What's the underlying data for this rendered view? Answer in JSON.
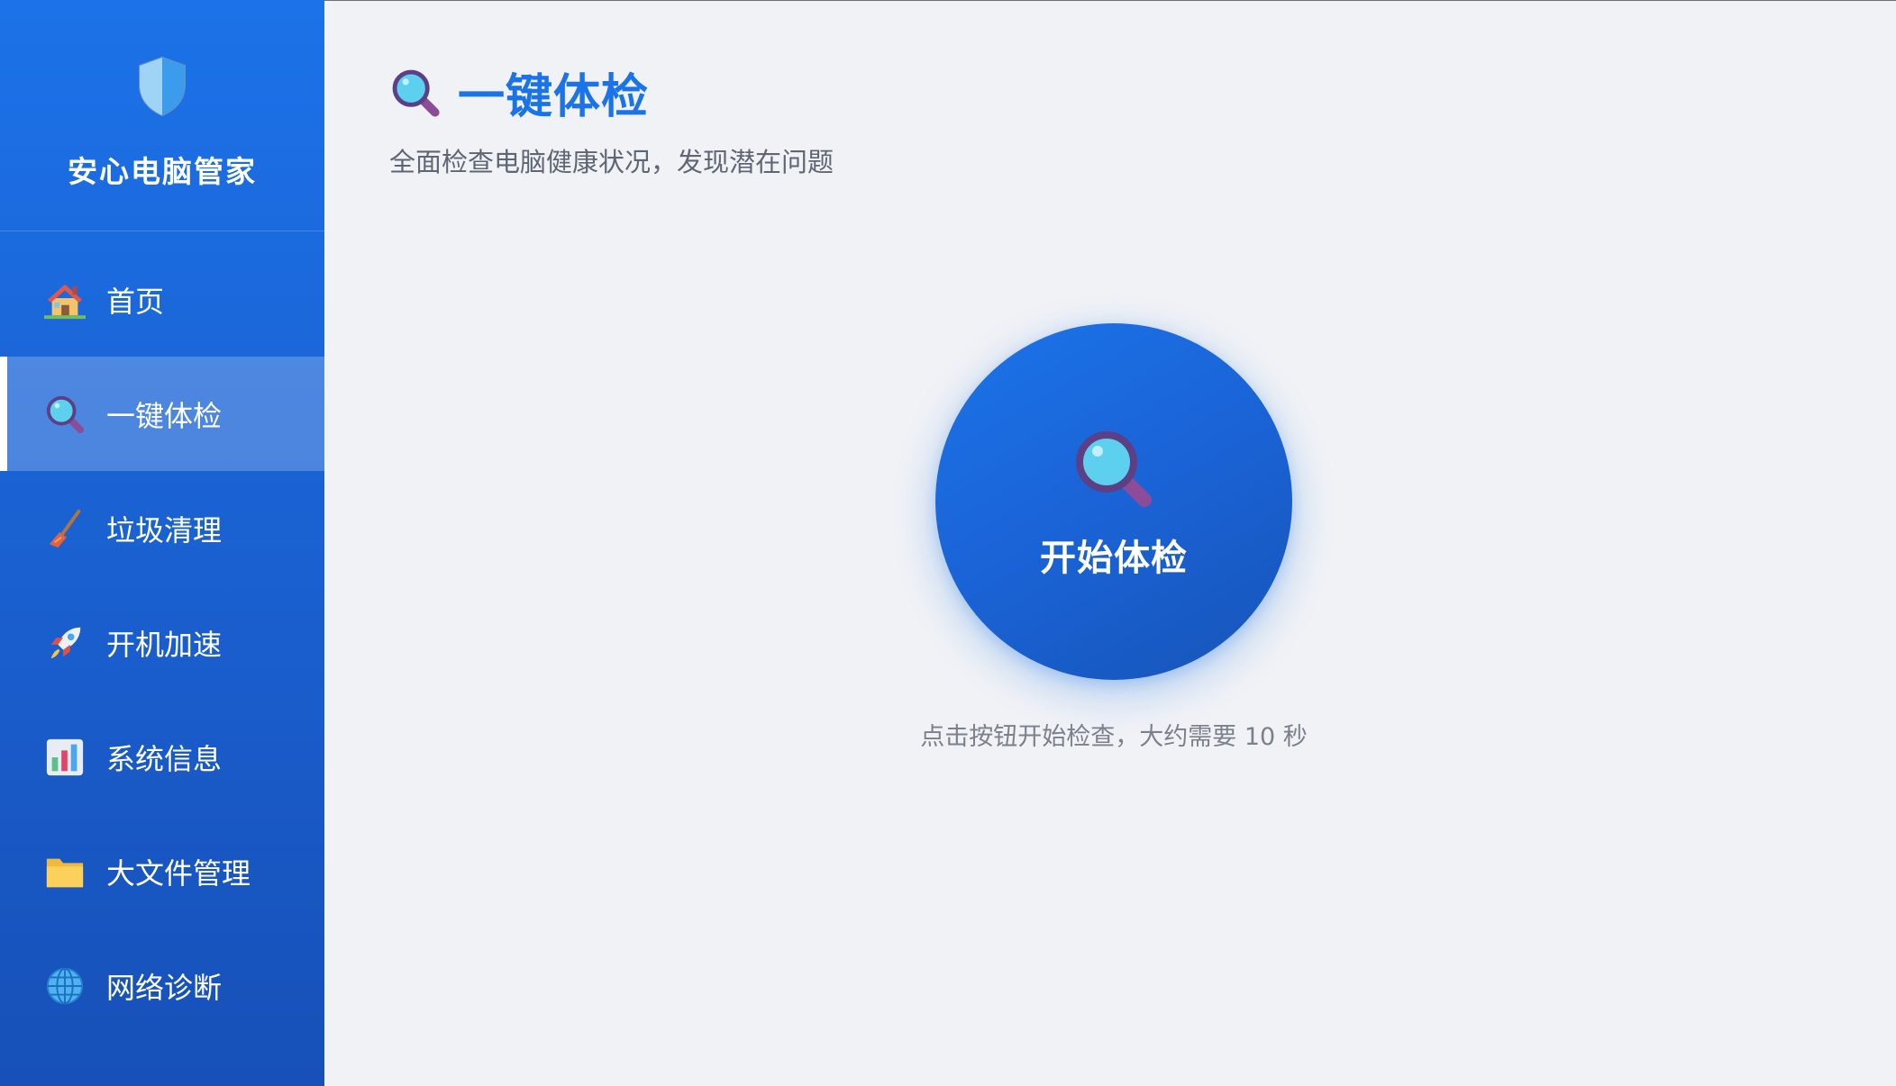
{
  "app": {
    "title": "安心电脑管家"
  },
  "sidebar": {
    "items": [
      {
        "label": "首页",
        "icon": "house-icon"
      },
      {
        "label": "一键体检",
        "icon": "magnifier-icon",
        "active": true
      },
      {
        "label": "垃圾清理",
        "icon": "broom-icon"
      },
      {
        "label": "开机加速",
        "icon": "rocket-icon"
      },
      {
        "label": "系统信息",
        "icon": "bar-chart-icon"
      },
      {
        "label": "大文件管理",
        "icon": "folder-icon"
      },
      {
        "label": "网络诊断",
        "icon": "globe-icon"
      }
    ]
  },
  "main": {
    "title": "一键体检",
    "subtitle": "全面检查电脑健康状况，发现潜在问题",
    "start_button_label": "开始体检",
    "hint": "点击按钮开始检查，大约需要 10 秒"
  },
  "colors": {
    "accent": "#1a73e8",
    "sidebar_top": "#1c72e8",
    "sidebar_bottom": "#1750b8",
    "background": "#f0f2f6"
  }
}
